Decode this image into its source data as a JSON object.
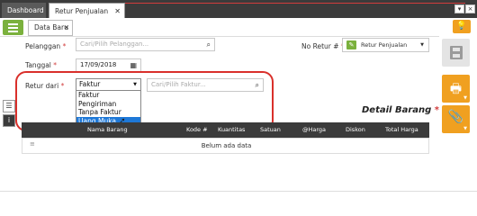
{
  "tabs": {
    "dashboard": "Dashboard",
    "retur": "Retur Penjualan",
    "close": "✕"
  },
  "toolbar": {
    "data_tab": "Data Baru",
    "close": "✕"
  },
  "form": {
    "pelanggan_label": "Pelanggan",
    "pelanggan_placeholder": "Cari/Pilih Pelanggan...",
    "tanggal_label": "Tanggal",
    "tanggal_value": "17/09/2018",
    "retur_dari_label": "Retur dari",
    "retur_dari_value": "Faktur",
    "faktur_placeholder": "Cari/Pilih Faktur...",
    "no_retur_label": "No Retur #",
    "no_retur_value": "Retur Penjualan",
    "required": "*"
  },
  "dropdown": {
    "options": [
      "Faktur",
      "Pengiriman",
      "Tanpa Faktur",
      "Uang Muka"
    ],
    "highlighted": "Uang Muka"
  },
  "detail": {
    "title": "Detail Barang",
    "required": "*",
    "columns": [
      "Nama Barang",
      "Kode #",
      "Kuantitas",
      "Satuan",
      "@Harga",
      "Diskon",
      "Total Harga"
    ],
    "empty_text": "Belum ada data",
    "row_handle": "≡"
  },
  "icons": {
    "list": "list-icon",
    "bulb": "lightbulb-icon",
    "save": "save-icon",
    "print": "print-icon",
    "attach": "paperclip-icon",
    "search": "search-icon",
    "calendar": "calendar-icon",
    "pencil": "pencil-icon"
  },
  "colors": {
    "accent_green": "#7bb13d",
    "accent_orange": "#f0a020",
    "selection_blue": "#1e78d7",
    "highlight_red": "#d9302b",
    "dark": "#3b3b3b"
  }
}
